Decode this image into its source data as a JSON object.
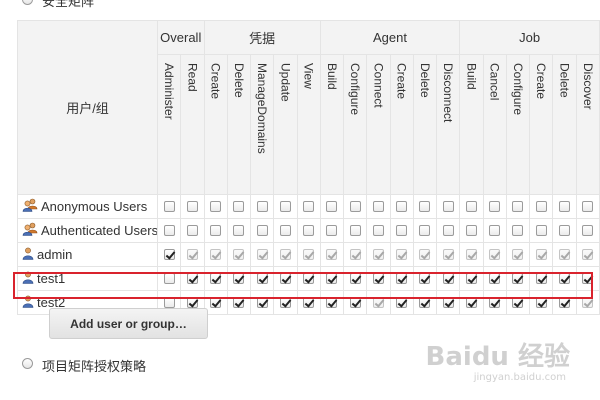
{
  "top_radio": {
    "label": "安全矩阵"
  },
  "table": {
    "user_column_header": "用户/组",
    "groups": [
      {
        "label": "Overall",
        "span": 2
      },
      {
        "label": "凭据",
        "span": 5
      },
      {
        "label": "Agent",
        "span": 6
      },
      {
        "label": "Job",
        "span": 6
      }
    ],
    "permissions": [
      "Administer",
      "Read",
      "Create",
      "Delete",
      "ManageDomains",
      "Update",
      "View",
      "Build",
      "Configure",
      "Connect",
      "Create",
      "Delete",
      "Disconnect",
      "Build",
      "Cancel",
      "Configure",
      "Create",
      "Delete",
      "Discover"
    ],
    "rows": [
      {
        "name": "Anonymous Users",
        "icon": "group-icon",
        "checked": [
          0,
          0,
          0,
          0,
          0,
          0,
          0,
          0,
          0,
          0,
          0,
          0,
          0,
          0,
          0,
          0,
          0,
          0,
          0
        ],
        "dimmed": [
          0,
          0,
          0,
          0,
          0,
          0,
          0,
          0,
          0,
          0,
          0,
          0,
          0,
          0,
          0,
          0,
          0,
          0,
          0
        ]
      },
      {
        "name": "Authenticated Users",
        "icon": "group-icon",
        "checked": [
          0,
          0,
          0,
          0,
          0,
          0,
          0,
          0,
          0,
          0,
          0,
          0,
          0,
          0,
          0,
          0,
          0,
          0,
          0
        ],
        "dimmed": [
          0,
          0,
          0,
          0,
          0,
          0,
          0,
          0,
          0,
          0,
          0,
          0,
          0,
          0,
          0,
          0,
          0,
          0,
          0
        ]
      },
      {
        "name": "admin",
        "icon": "user-icon",
        "checked": [
          1,
          1,
          1,
          1,
          1,
          1,
          1,
          1,
          1,
          1,
          1,
          1,
          1,
          1,
          1,
          1,
          1,
          1,
          1
        ],
        "dimmed": [
          0,
          1,
          1,
          1,
          1,
          1,
          1,
          1,
          1,
          1,
          1,
          1,
          1,
          1,
          1,
          1,
          1,
          1,
          1
        ]
      },
      {
        "name": "test1",
        "icon": "user-icon",
        "checked": [
          0,
          1,
          1,
          1,
          1,
          1,
          1,
          1,
          1,
          1,
          1,
          1,
          1,
          1,
          1,
          1,
          1,
          1,
          1
        ],
        "dimmed": [
          0,
          0,
          0,
          0,
          0,
          0,
          0,
          0,
          0,
          0,
          0,
          0,
          0,
          0,
          0,
          0,
          0,
          0,
          0
        ]
      },
      {
        "name": "test2",
        "icon": "user-icon",
        "checked": [
          0,
          1,
          1,
          1,
          1,
          1,
          1,
          1,
          1,
          1,
          1,
          1,
          1,
          1,
          1,
          1,
          1,
          1,
          1
        ],
        "dimmed": [
          0,
          0,
          0,
          0,
          0,
          0,
          0,
          0,
          0,
          1,
          0,
          0,
          0,
          0,
          0,
          0,
          0,
          0,
          1
        ]
      }
    ]
  },
  "add_button": {
    "label": "Add user or group…"
  },
  "bottom_radio": {
    "label": "项目矩阵授权策略"
  },
  "watermark": {
    "text": "Baidu 经验",
    "sub": "jingyan.baidu.com"
  },
  "colors": {
    "highlight": "#d9232d",
    "header_bg": "#f3f3f3"
  }
}
